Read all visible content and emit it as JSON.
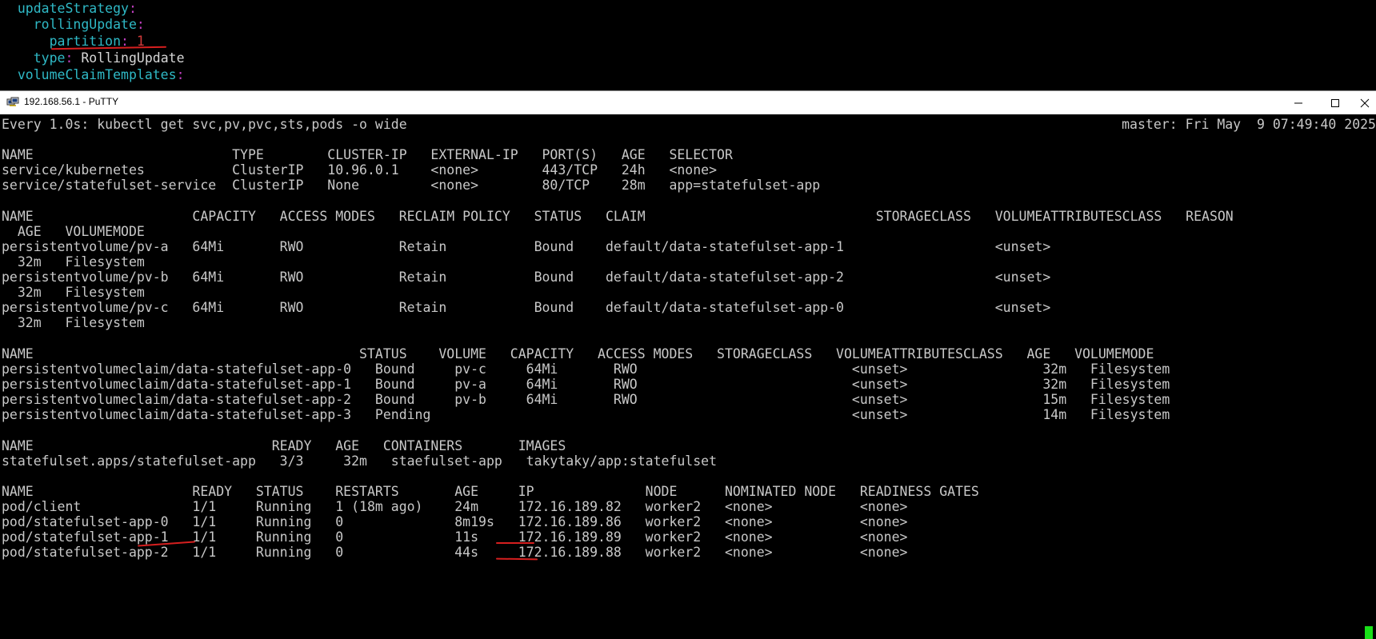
{
  "background_editor": {
    "lines": [
      {
        "indent": "  ",
        "key": "updateStrategy",
        "colon": ":",
        "value": ""
      },
      {
        "indent": "    ",
        "key": "rollingUpdate",
        "colon": ":",
        "value": ""
      },
      {
        "indent": "      ",
        "key": "partition",
        "colon": ":",
        "value": " 1"
      },
      {
        "indent": "    ",
        "key": "type",
        "colon": ":",
        "value": " RollingUpdate"
      },
      {
        "indent": "  ",
        "key": "volumeClaimTemplates",
        "colon": ":",
        "value": ""
      }
    ]
  },
  "window": {
    "title": "192.168.56.1 - PuTTY",
    "minimize_glyph": "—",
    "maximize_glyph": "☐",
    "close_glyph": "✕"
  },
  "terminal": {
    "header_left": "Every 1.0s: kubectl get svc,pv,pvc,sts,pods -o wide",
    "header_right": "master: Fri May  9 07:49:40 2025",
    "lines": [
      "",
      "NAME                         TYPE        CLUSTER-IP   EXTERNAL-IP   PORT(S)   AGE   SELECTOR",
      "service/kubernetes           ClusterIP   10.96.0.1    <none>        443/TCP   24h   <none>",
      "service/statefulset-service  ClusterIP   None         <none>        80/TCP    28m   app=statefulset-app",
      "",
      "NAME                    CAPACITY   ACCESS MODES   RECLAIM POLICY   STATUS   CLAIM                             STORAGECLASS   VOLUMEATTRIBUTESCLASS   REASON",
      "  AGE   VOLUMEMODE",
      "persistentvolume/pv-a   64Mi       RWO            Retain           Bound    default/data-statefulset-app-1                   <unset>",
      "  32m   Filesystem",
      "persistentvolume/pv-b   64Mi       RWO            Retain           Bound    default/data-statefulset-app-2                   <unset>",
      "  32m   Filesystem",
      "persistentvolume/pv-c   64Mi       RWO            Retain           Bound    default/data-statefulset-app-0                   <unset>",
      "  32m   Filesystem",
      "",
      "NAME                                         STATUS    VOLUME   CAPACITY   ACCESS MODES   STORAGECLASS   VOLUMEATTRIBUTESCLASS   AGE   VOLUMEMODE",
      "persistentvolumeclaim/data-statefulset-app-0   Bound     pv-c     64Mi       RWO                           <unset>                 32m   Filesystem",
      "persistentvolumeclaim/data-statefulset-app-1   Bound     pv-a     64Mi       RWO                           <unset>                 32m   Filesystem",
      "persistentvolumeclaim/data-statefulset-app-2   Bound     pv-b     64Mi       RWO                           <unset>                 15m   Filesystem",
      "persistentvolumeclaim/data-statefulset-app-3   Pending                                                     <unset>                 14m   Filesystem",
      "",
      "NAME                              READY   AGE   CONTAINERS       IMAGES",
      "statefulset.apps/statefulset-app   3/3     32m   staefulset-app   takytaky/app:statefulset",
      "",
      "NAME                    READY   STATUS    RESTARTS       AGE     IP              NODE      NOMINATED NODE   READINESS GATES",
      "pod/client              1/1     Running   1 (18m ago)    24m     172.16.189.82   worker2   <none>           <none>",
      "pod/statefulset-app-0   1/1     Running   0              8m19s   172.16.189.86   worker2   <none>           <none>",
      "pod/statefulset-app-1   1/1     Running   0              11s     172.16.189.89   worker2   <none>           <none>",
      "pod/statefulset-app-2   1/1     Running   0              44s     172.16.189.88   worker2   <none>           <none>"
    ]
  }
}
